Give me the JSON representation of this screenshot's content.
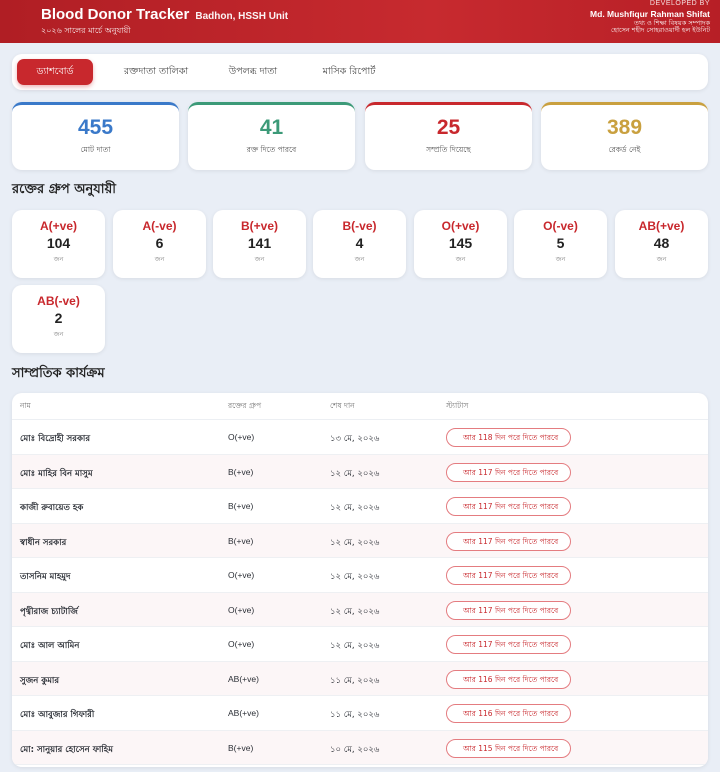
{
  "header": {
    "title": "Blood Donor Tracker",
    "unit": "Badhon, HSSH Unit",
    "subtitle": "২০২৬ সালের মার্চে অনুযায়ী",
    "developed_by_label": "DEVELOPED BY",
    "developer_name": "Md. Mushfiqur Rahman Shifat",
    "developer_line1": "তথ্য ও শিক্ষা বিষয়ক সম্পাদক",
    "developer_line2": "হোসেন শহীদ সোহরাওয়ার্দী হল ইউনিট"
  },
  "nav": {
    "tabs": [
      {
        "label": "ড্যাশবোর্ড",
        "active": true
      },
      {
        "label": "রক্তদাতা তালিকা",
        "active": false
      },
      {
        "label": "উপলব্ধ দাতা",
        "active": false
      },
      {
        "label": "মাসিক রিপোর্ট",
        "active": false
      }
    ]
  },
  "stats": [
    {
      "value": "455",
      "label": "মোট দাতা",
      "color": "#3a79c9"
    },
    {
      "value": "41",
      "label": "রক্ত দিতে পারবে",
      "color": "#3c9a78"
    },
    {
      "value": "25",
      "label": "সম্প্রতি দিয়েছে",
      "color": "#c8282d"
    },
    {
      "value": "389",
      "label": "রেকর্ড নেই",
      "color": "#c9a03f"
    }
  ],
  "blood_groups": {
    "title": "রক্তের গ্রুপ অনুযায়ী",
    "unit_label": "জন",
    "items": [
      {
        "type": "A(+ve)",
        "count": "104"
      },
      {
        "type": "A(-ve)",
        "count": "6"
      },
      {
        "type": "B(+ve)",
        "count": "141"
      },
      {
        "type": "B(-ve)",
        "count": "4"
      },
      {
        "type": "O(+ve)",
        "count": "145"
      },
      {
        "type": "O(-ve)",
        "count": "5"
      },
      {
        "type": "AB(+ve)",
        "count": "48"
      },
      {
        "type": "AB(-ve)",
        "count": "2"
      }
    ]
  },
  "recent": {
    "title": "সাম্প্রতিক কার্যক্রম",
    "columns": [
      "নাম",
      "রক্তের গ্রুপ",
      "শেষ দান",
      "স্ট্যাটাস"
    ],
    "rows": [
      {
        "name": "মোঃ বিদ্রোহী সরকার",
        "group": "O(+ve)",
        "date": "১৩ মে, ২০২৬",
        "status": "আর 118 দিন পরে দিতে পারবে"
      },
      {
        "name": "মোঃ মাহির বিন মাসুম",
        "group": "B(+ve)",
        "date": "১২ মে, ২০২৬",
        "status": "আর 117 দিন পরে দিতে পারবে"
      },
      {
        "name": "কাজী রুবায়েত হক",
        "group": "B(+ve)",
        "date": "১২ মে, ২০২৬",
        "status": "আর 117 দিন পরে দিতে পারবে"
      },
      {
        "name": "স্বাধীন সরকার",
        "group": "B(+ve)",
        "date": "১২ মে, ২০২৬",
        "status": "আর 117 দিন পরে দিতে পারবে"
      },
      {
        "name": "তাসনিম মাহমুদ",
        "group": "O(+ve)",
        "date": "১২ মে, ২০২৬",
        "status": "আর 117 দিন পরে দিতে পারবে"
      },
      {
        "name": "পৃথ্বীরাজ চ্যাটার্জি",
        "group": "O(+ve)",
        "date": "১২ মে, ২০২৬",
        "status": "আর 117 দিন পরে দিতে পারবে"
      },
      {
        "name": "মোঃ আল আমিন",
        "group": "O(+ve)",
        "date": "১২ মে, ২০২৬",
        "status": "আর 117 দিন পরে দিতে পারবে"
      },
      {
        "name": "সুজন কুমার",
        "group": "AB(+ve)",
        "date": "১১ মে, ২০২৬",
        "status": "আর 116 দিন পরে দিতে পারবে"
      },
      {
        "name": "মোঃ আবুজার গিফারী",
        "group": "AB(+ve)",
        "date": "১১ মে, ২০২৬",
        "status": "আর 116 দিন পরে দিতে পারবে"
      },
      {
        "name": "মো: সানুয়ার হোসেন ফাহিম",
        "group": "B(+ve)",
        "date": "১০ মে, ২০২৬",
        "status": "আর 115 দিন পরে দিতে পারবে"
      }
    ]
  }
}
